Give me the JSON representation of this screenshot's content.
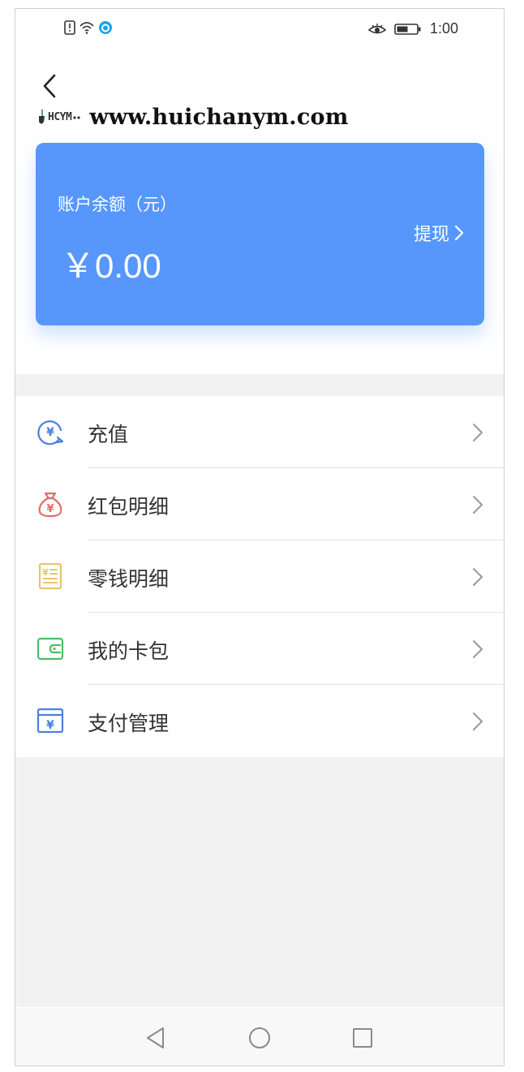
{
  "status_bar": {
    "time": "1:00"
  },
  "watermark": {
    "logo_text": "HCYM",
    "url": "www.huichanym.com"
  },
  "balance_card": {
    "label": "账户余额（元）",
    "amount": "￥0.00",
    "withdraw_label": "提现"
  },
  "menu": {
    "items": [
      {
        "label": "充值",
        "icon": "recharge-icon",
        "color": "#4a7fe0"
      },
      {
        "label": "红包明细",
        "icon": "money-bag-icon",
        "color": "#e86a6a"
      },
      {
        "label": "零钱明细",
        "icon": "ledger-icon",
        "color": "#e8c56a"
      },
      {
        "label": "我的卡包",
        "icon": "wallet-icon",
        "color": "#4cbd6a"
      },
      {
        "label": "支付管理",
        "icon": "payment-icon",
        "color": "#4a7fe0"
      }
    ]
  },
  "colors": {
    "card": "#5797fc",
    "page_bg": "#f2f2f2",
    "text": "#333333"
  }
}
